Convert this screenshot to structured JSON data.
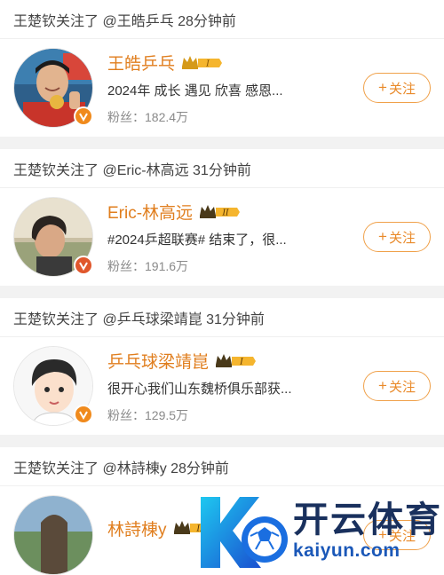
{
  "feed": [
    {
      "notice": "王楚钦关注了 @王皓乒乓 28分钟前",
      "name": "王皓乒乓",
      "level": "I",
      "desc": "2024年 成长 遇见 欣喜 感恩...",
      "fans": "粉丝：182.4万",
      "follow": "关注"
    },
    {
      "notice": "王楚钦关注了 @Eric-林高远 31分钟前",
      "name": "Eric-林高远",
      "level": "II",
      "desc": "#2024乒超联赛# 结束了，很...",
      "fans": "粉丝：191.6万",
      "follow": "关注"
    },
    {
      "notice": "王楚钦关注了 @乒乓球梁靖崑 31分钟前",
      "name": "乒乓球梁靖崑",
      "level": "I",
      "desc": "很开心我们山东魏桥俱乐部获...",
      "fans": "粉丝：129.5万",
      "follow": "关注"
    },
    {
      "notice": "王楚钦关注了 @林詩棟y 28分钟前",
      "name": "林詩棟y",
      "level": "II",
      "desc": "",
      "fans": "",
      "follow": "关注"
    }
  ],
  "watermark": {
    "cn": "开云体育",
    "en": "kaiyun.com"
  },
  "colors": {
    "name": "#e07e1e",
    "follow_border": "#f0a14a",
    "vbadge": "#f08a1c",
    "level_badge": "#f5b52e"
  }
}
